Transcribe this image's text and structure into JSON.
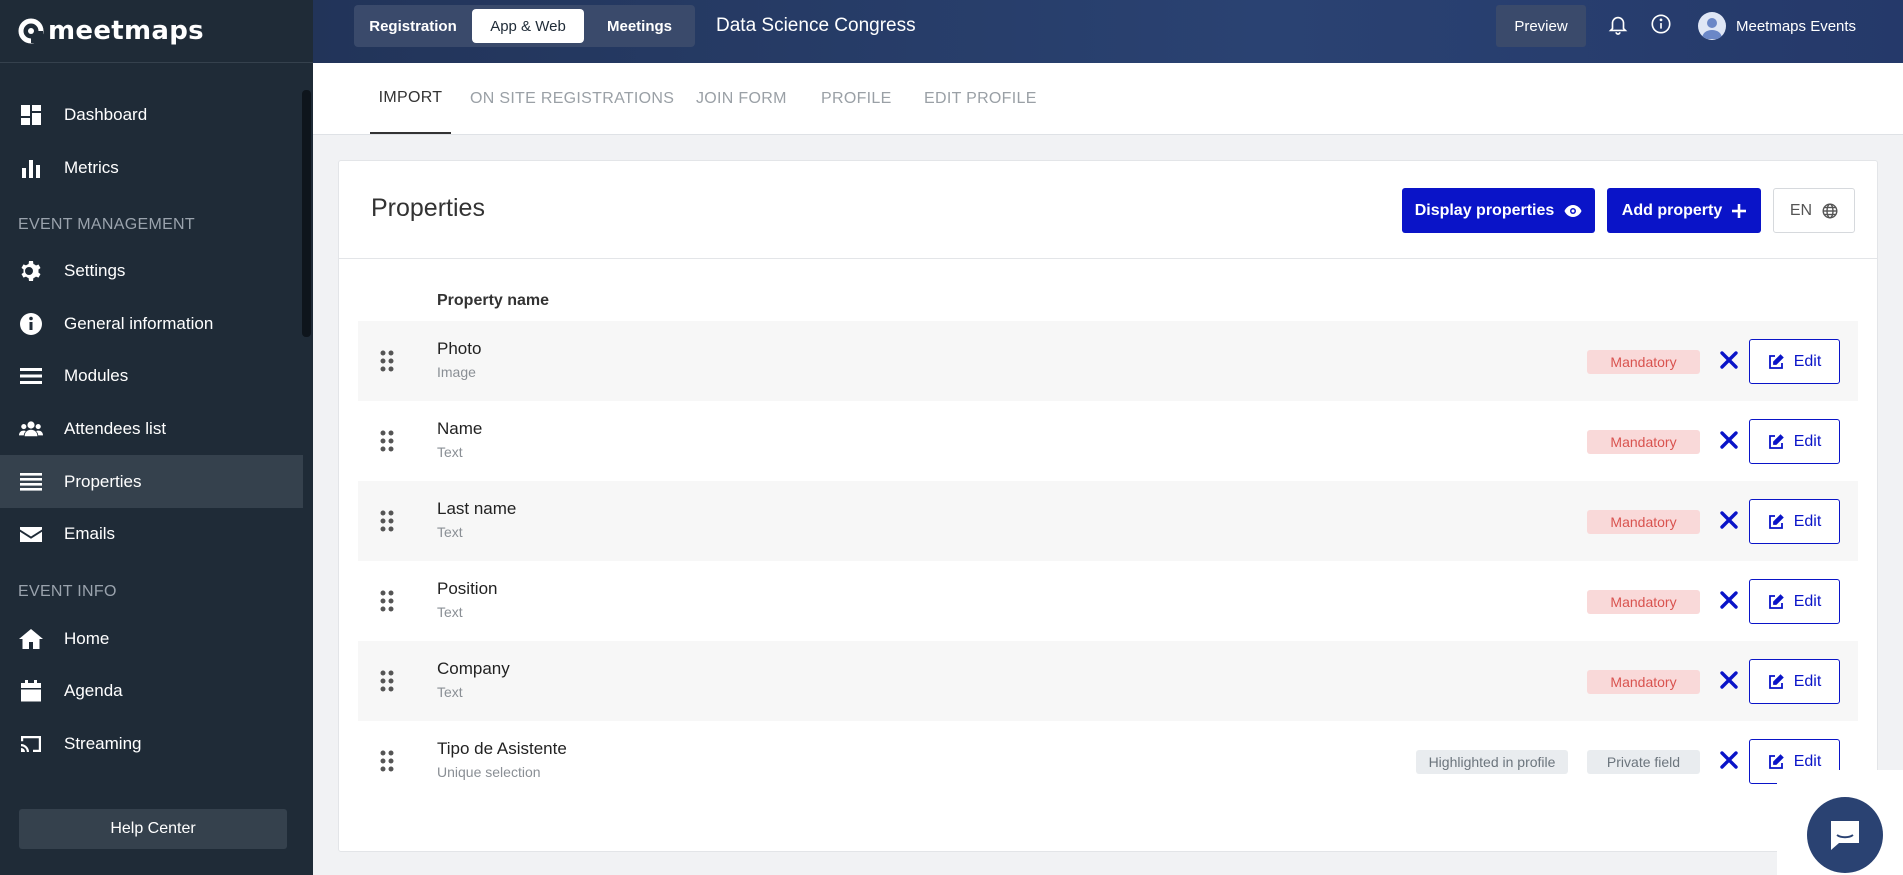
{
  "brand": {
    "name": "meetmaps"
  },
  "sidebar": {
    "items": [
      {
        "label": "Dashboard",
        "icon": "dashboard-icon"
      },
      {
        "label": "Metrics",
        "icon": "bar-chart-icon"
      },
      {
        "label": "Settings",
        "icon": "gear-icon"
      },
      {
        "label": "General information",
        "icon": "info-icon"
      },
      {
        "label": "Modules",
        "icon": "menu-icon"
      },
      {
        "label": "Attendees list",
        "icon": "users-icon"
      },
      {
        "label": "Properties",
        "icon": "list-icon",
        "active": true
      },
      {
        "label": "Emails",
        "icon": "envelope-icon"
      },
      {
        "label": "Home",
        "icon": "home-icon"
      },
      {
        "label": "Agenda",
        "icon": "calendar-icon"
      },
      {
        "label": "Streaming",
        "icon": "cast-icon"
      }
    ],
    "sections": {
      "event_management": "EVENT MANAGEMENT",
      "event_info": "EVENT INFO"
    },
    "help_center": "Help Center"
  },
  "topbar": {
    "modes": [
      "Registration",
      "App & Web",
      "Meetings"
    ],
    "active_mode": "App & Web",
    "event_title": "Data Science Congress",
    "preview_label": "Preview",
    "user_name": "Meetmaps Events"
  },
  "tabs": [
    "IMPORT",
    "ON SITE REGISTRATIONS",
    "JOIN FORM",
    "PROFILE",
    "EDIT PROFILE"
  ],
  "active_tab": "IMPORT",
  "card": {
    "title": "Properties",
    "display_properties_label": "Display properties",
    "add_property_label": "Add property",
    "language": "EN",
    "column_header": "Property name"
  },
  "properties": [
    {
      "name": "Photo",
      "type": "Image",
      "badges": [
        "Mandatory"
      ]
    },
    {
      "name": "Name",
      "type": "Text",
      "badges": [
        "Mandatory"
      ]
    },
    {
      "name": "Last name",
      "type": "Text",
      "badges": [
        "Mandatory"
      ]
    },
    {
      "name": "Position",
      "type": "Text",
      "badges": [
        "Mandatory"
      ]
    },
    {
      "name": "Company",
      "type": "Text",
      "badges": [
        "Mandatory"
      ]
    },
    {
      "name": "Tipo de Asistente",
      "type": "Unique selection",
      "badges": [
        "Highlighted in profile",
        "Private field"
      ]
    }
  ],
  "edit_label": "Edit",
  "colors": {
    "sidebar_bg": "#1f2b37",
    "primary": "#0a14c8",
    "mandatory_text": "#d9534f",
    "mandatory_bg": "#f9d9d9"
  }
}
